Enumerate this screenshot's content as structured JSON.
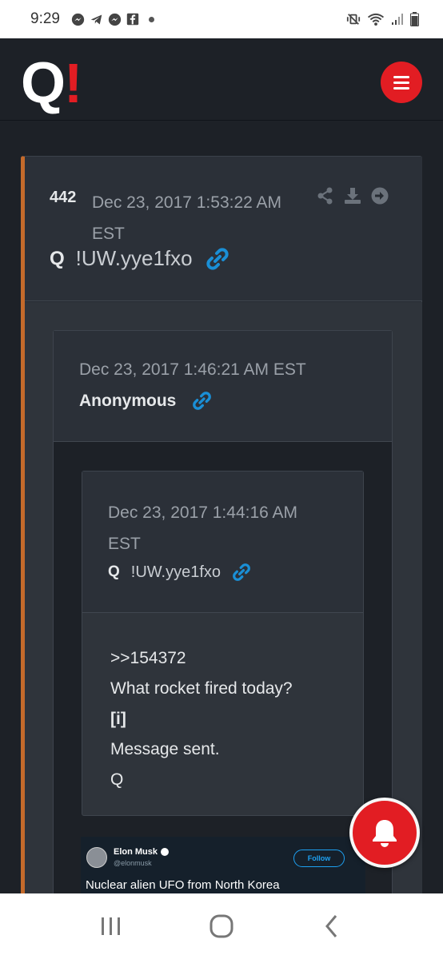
{
  "status_bar": {
    "time": "9:29",
    "left_icons": [
      "messenger-icon",
      "telegram-icon",
      "messenger-icon",
      "facebook-icon",
      "dot-icon"
    ],
    "right_icons": [
      "mute-vibrate-icon",
      "wifi-icon",
      "signal-icon",
      "battery-icon"
    ]
  },
  "header": {
    "logo_letter": "Q",
    "logo_mark": "!",
    "menu_icon": "hamburger-icon",
    "accent_color": "#e21d23"
  },
  "post": {
    "number": "442",
    "date": "Dec 23, 2017 1:53:22 AM EST",
    "author_q": "Q",
    "tripcode": "!UW.yye1fxo",
    "action_icons": [
      "share-icon",
      "download-icon",
      "arrow-right-circle-icon"
    ],
    "border_color": "#c46a2b"
  },
  "quote1": {
    "date": "Dec 23, 2017 1:46:21 AM EST",
    "author": "Anonymous"
  },
  "quote2": {
    "date": "Dec 23, 2017 1:44:16 AM EST",
    "author_q": "Q",
    "tripcode": "!UW.yye1fxo",
    "lines": [
      ">>154372",
      "What rocket fired today?",
      "[i]",
      "Message sent.",
      "Q"
    ]
  },
  "tweet": {
    "name": "Elon Musk",
    "handle": "@elonmusk",
    "follow_label": "Follow",
    "text": "Nuclear alien UFO from North Korea"
  },
  "fab": {
    "icon": "bell-icon"
  },
  "nav": {
    "icons": [
      "recent-apps-icon",
      "home-icon",
      "back-icon"
    ]
  }
}
